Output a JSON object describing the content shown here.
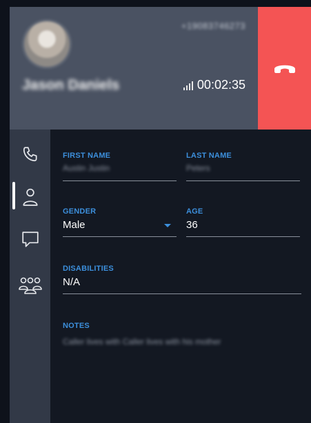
{
  "call": {
    "phone_number": "+19083746273",
    "caller_name": "Jason Daniels",
    "duration": "00:02:35"
  },
  "icons": {
    "avatar": "caller-photo",
    "hangup": "phone-hangup-icon",
    "signal": "signal-bars-icon",
    "rail": [
      "phone-icon",
      "person-icon",
      "chat-icon",
      "group-icon"
    ]
  },
  "colors": {
    "header": "#4a5262",
    "hangup": "#f45454",
    "rail": "#323947",
    "form_bg": "#131822",
    "label_accent": "#3c8fdc"
  },
  "form": {
    "first_name": {
      "label": "FIRST NAME",
      "value": "Austin Justin"
    },
    "last_name": {
      "label": "LAST NAME",
      "value": "Peters"
    },
    "gender": {
      "label": "GENDER",
      "value": "Male"
    },
    "age": {
      "label": "AGE",
      "value": "36"
    },
    "disabilities": {
      "label": "DISABILITIES",
      "value": "N/A"
    },
    "notes": {
      "label": "NOTES",
      "value": "Caller lives with Caller lives with his mother"
    }
  }
}
